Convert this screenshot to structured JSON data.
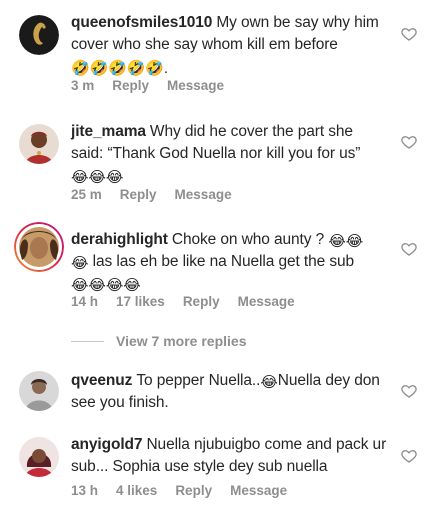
{
  "comments": [
    {
      "username": "queenofsmiles1010",
      "text": "My own be say why him cover who she say whom kill em before",
      "emojis": "🤣🤣🤣🤣🤣.",
      "time": "3 m",
      "likes": "",
      "reply_label": "Reply",
      "message_label": "Message"
    },
    {
      "username": "jite_mama",
      "text": "Why did he cover the part she said: “Thank God Nuella nor kill you for us”",
      "emojis": "😂😂😂",
      "time": "25 m",
      "likes": "",
      "reply_label": "Reply",
      "message_label": "Message"
    },
    {
      "username": "derahighlight",
      "text_a": "Choke on who aunty ?",
      "emojis_a": "😂😂",
      "emojis_b": "😂",
      "text_b": "las las eh be like na Nuella get the sub",
      "emojis_c": "😂😂😂😂",
      "time": "14 h",
      "likes": "17 likes",
      "reply_label": "Reply",
      "message_label": "Message"
    },
    {
      "username": "qveenuz",
      "text_a": "To pepper Nuella..",
      "emojis_a": "😂",
      "text_b": "Nuella dey don see you finish.",
      "time": "",
      "likes": "",
      "reply_label": "",
      "message_label": ""
    },
    {
      "username": "anyigold7",
      "text": "Nuella njubuigbo come and pack ur sub... Sophia use style dey sub nuella",
      "time": "13 h",
      "likes": "4 likes",
      "reply_label": "Reply",
      "message_label": "Message"
    }
  ],
  "view_more_replies": "View 7 more replies",
  "colors": {
    "text": "#262626",
    "meta": "#8e8e8e",
    "story_ring_start": "#f09433",
    "story_ring_end": "#bc1888"
  },
  "icons": [
    "heart-icon",
    "avatar"
  ]
}
